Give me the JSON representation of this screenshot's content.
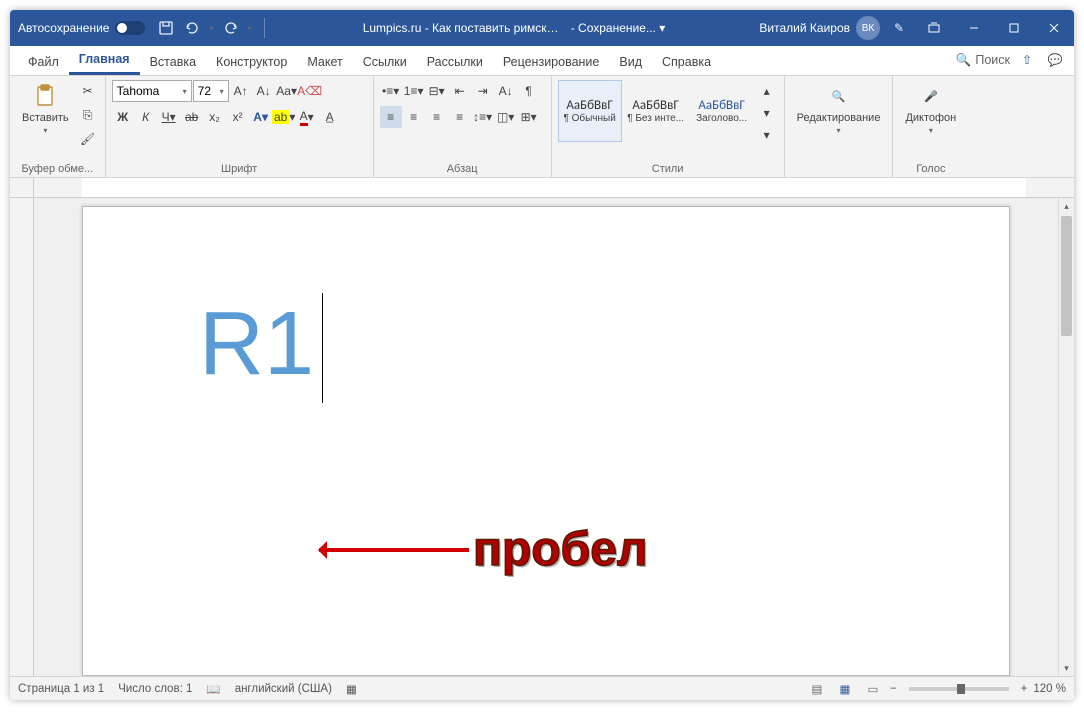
{
  "titlebar": {
    "autosave": "Автосохранение",
    "doc_title": "Lumpics.ru - Как поставить римские...",
    "saving": "Сохранение...",
    "user_name": "Виталий Каиров",
    "user_initials": "ВК"
  },
  "tabs": {
    "file": "Файл",
    "home": "Главная",
    "insert": "Вставка",
    "design": "Конструктор",
    "layout": "Макет",
    "references": "Ссылки",
    "mailings": "Рассылки",
    "review": "Рецензирование",
    "view": "Вид",
    "help": "Справка",
    "search": "Поиск"
  },
  "ribbon": {
    "clipboard": {
      "paste": "Вставить",
      "label": "Буфер обме..."
    },
    "font": {
      "name": "Tahoma",
      "size": "72",
      "bold": "Ж",
      "italic": "К",
      "underline": "Ч",
      "strike": "ab",
      "sub": "x₂",
      "sup": "x²",
      "label": "Шрифт"
    },
    "paragraph": {
      "label": "Абзац"
    },
    "styles": {
      "preview": "АаБбВвГ",
      "s1": "¶ Обычный",
      "s2": "¶ Без инте...",
      "s3": "Заголово...",
      "label": "Стили"
    },
    "editing": {
      "label": "Редактирование"
    },
    "voice": {
      "dictate": "Диктофон",
      "label": "Голос"
    }
  },
  "document": {
    "text": "R1",
    "annotation": "пробел"
  },
  "statusbar": {
    "page": "Страница 1 из 1",
    "words": "Число слов: 1",
    "lang": "английский (США)",
    "zoom": "120 %",
    "minus": "−",
    "plus": "+"
  }
}
